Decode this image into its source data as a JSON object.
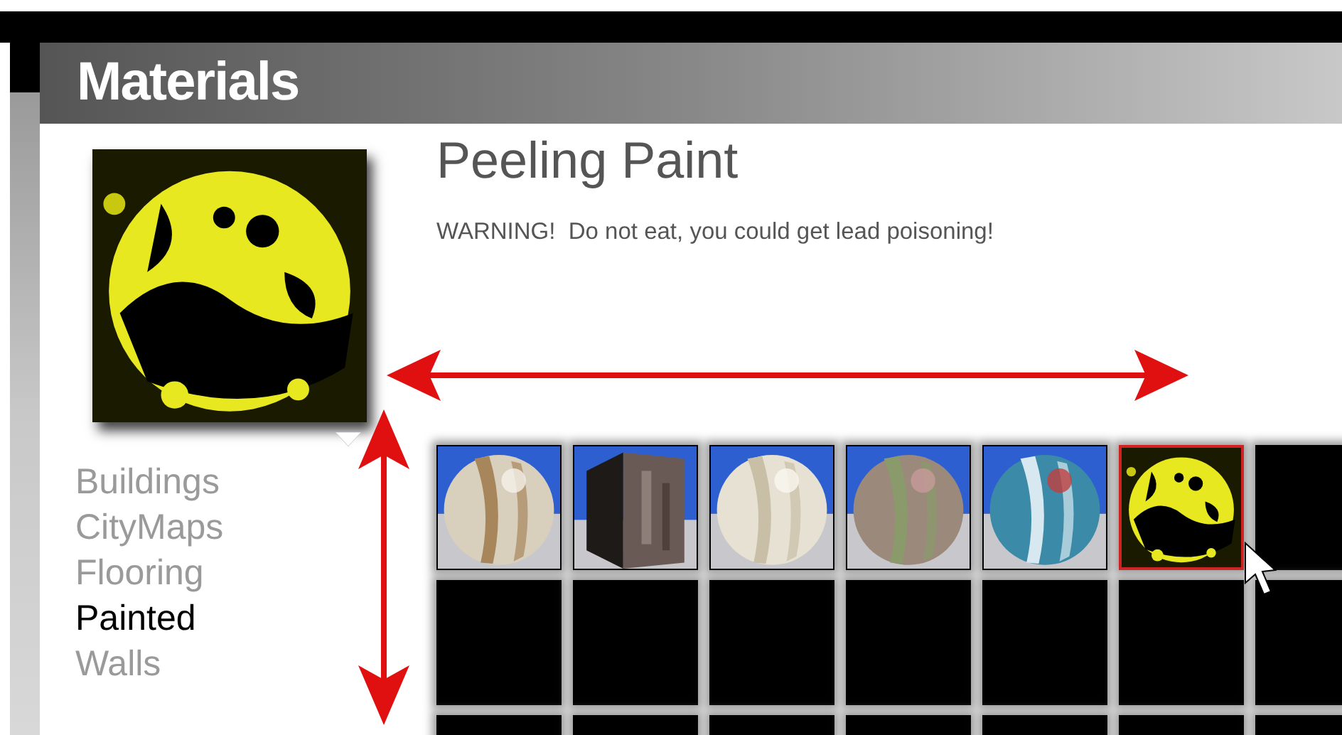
{
  "window": {
    "title": "Materials"
  },
  "material": {
    "name": "Peeling Paint",
    "description": "WARNING!  Do not eat, you could get lead poisoning!"
  },
  "categories": [
    {
      "label": "Buildings",
      "selected": false
    },
    {
      "label": "CityMaps",
      "selected": false
    },
    {
      "label": "Flooring",
      "selected": false
    },
    {
      "label": "Painted",
      "selected": true
    },
    {
      "label": "Walls",
      "selected": false
    }
  ],
  "swatches": [
    {
      "kind": "marble",
      "selected": false
    },
    {
      "kind": "stone-cube",
      "selected": false
    },
    {
      "kind": "plaster",
      "selected": false
    },
    {
      "kind": "granite",
      "selected": false
    },
    {
      "kind": "mosaic",
      "selected": false
    },
    {
      "kind": "peeling",
      "selected": true
    },
    {
      "kind": "empty",
      "selected": false
    },
    {
      "kind": "empty",
      "selected": false
    },
    {
      "kind": "empty",
      "selected": false
    },
    {
      "kind": "empty",
      "selected": false
    },
    {
      "kind": "empty",
      "selected": false
    },
    {
      "kind": "empty",
      "selected": false
    },
    {
      "kind": "empty",
      "selected": false
    },
    {
      "kind": "empty",
      "selected": false
    },
    {
      "kind": "empty",
      "selected": false
    },
    {
      "kind": "empty",
      "selected": false
    },
    {
      "kind": "empty",
      "selected": false
    },
    {
      "kind": "empty",
      "selected": false
    },
    {
      "kind": "empty",
      "selected": false
    },
    {
      "kind": "empty",
      "selected": false
    },
    {
      "kind": "empty",
      "selected": false
    }
  ]
}
